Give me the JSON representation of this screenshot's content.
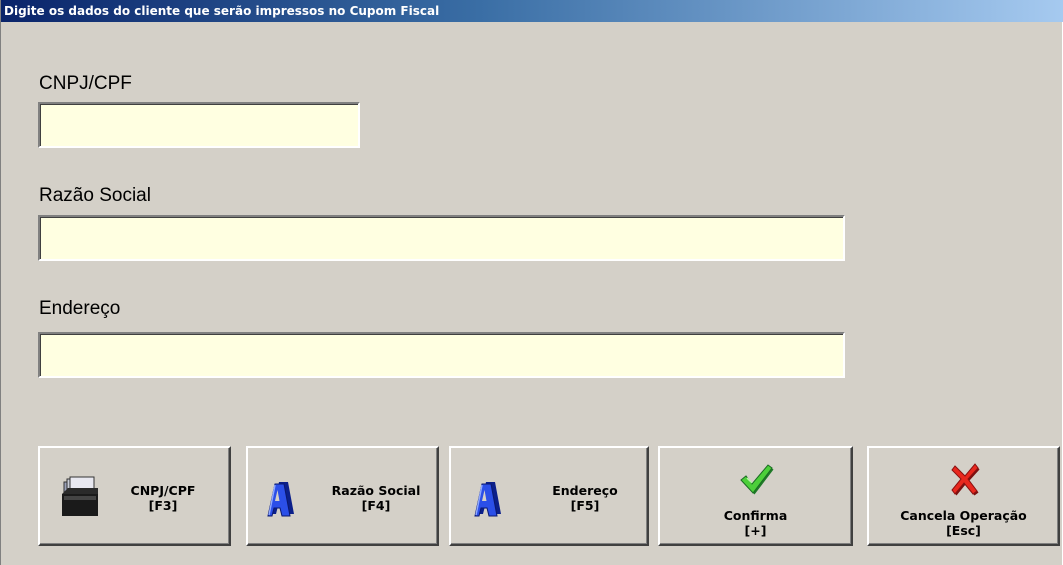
{
  "window": {
    "title": "Digite os dados do cliente que serão impressos no Cupom Fiscal"
  },
  "fields": {
    "cnpj": {
      "label": "CNPJ/CPF",
      "value": ""
    },
    "razao": {
      "label": "Razão Social",
      "value": ""
    },
    "endereco": {
      "label": "Endereço",
      "value": ""
    }
  },
  "buttons": {
    "cnpj": {
      "label": "CNPJ/CPF",
      "shortcut": "[F3]",
      "icon": "card-file-icon"
    },
    "razao": {
      "label": "Razão Social",
      "shortcut": "[F4]",
      "icon": "letter-a-icon"
    },
    "endereco": {
      "label": "Endereço",
      "shortcut": "[F5]",
      "icon": "letter-a-icon"
    },
    "confirma": {
      "label": "Confirma",
      "shortcut": "[+]",
      "icon": "green-check-icon"
    },
    "cancela": {
      "label": "Cancela Operação",
      "shortcut": "[Esc]",
      "icon": "red-x-icon"
    }
  },
  "colors": {
    "title_start": "#0a246a",
    "title_end": "#a6caf0",
    "window_bg": "#d4d0c8",
    "input_bg": "#ffffe1",
    "check": "#3cb54a",
    "cross": "#e0201a",
    "letter_a": "#1a3bd0"
  }
}
